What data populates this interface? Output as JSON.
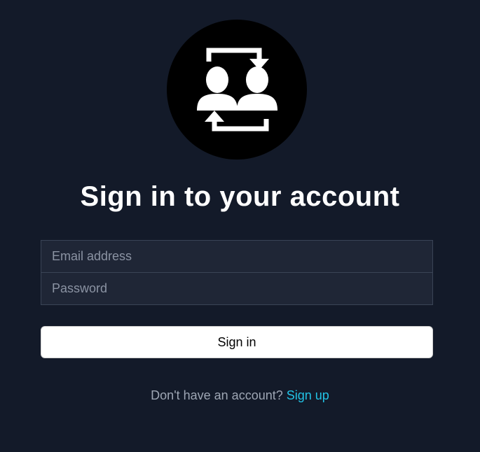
{
  "logo": {
    "icon": "user-swap-icon"
  },
  "title": "Sign in to your account",
  "form": {
    "email_placeholder": "Email address",
    "password_placeholder": "Password",
    "submit_label": "Sign in"
  },
  "signup": {
    "prompt": "Don't have an account?",
    "link_label": "Sign up"
  },
  "colors": {
    "background": "#131a29",
    "field_background": "#1f2636",
    "link": "#22c3e6"
  }
}
